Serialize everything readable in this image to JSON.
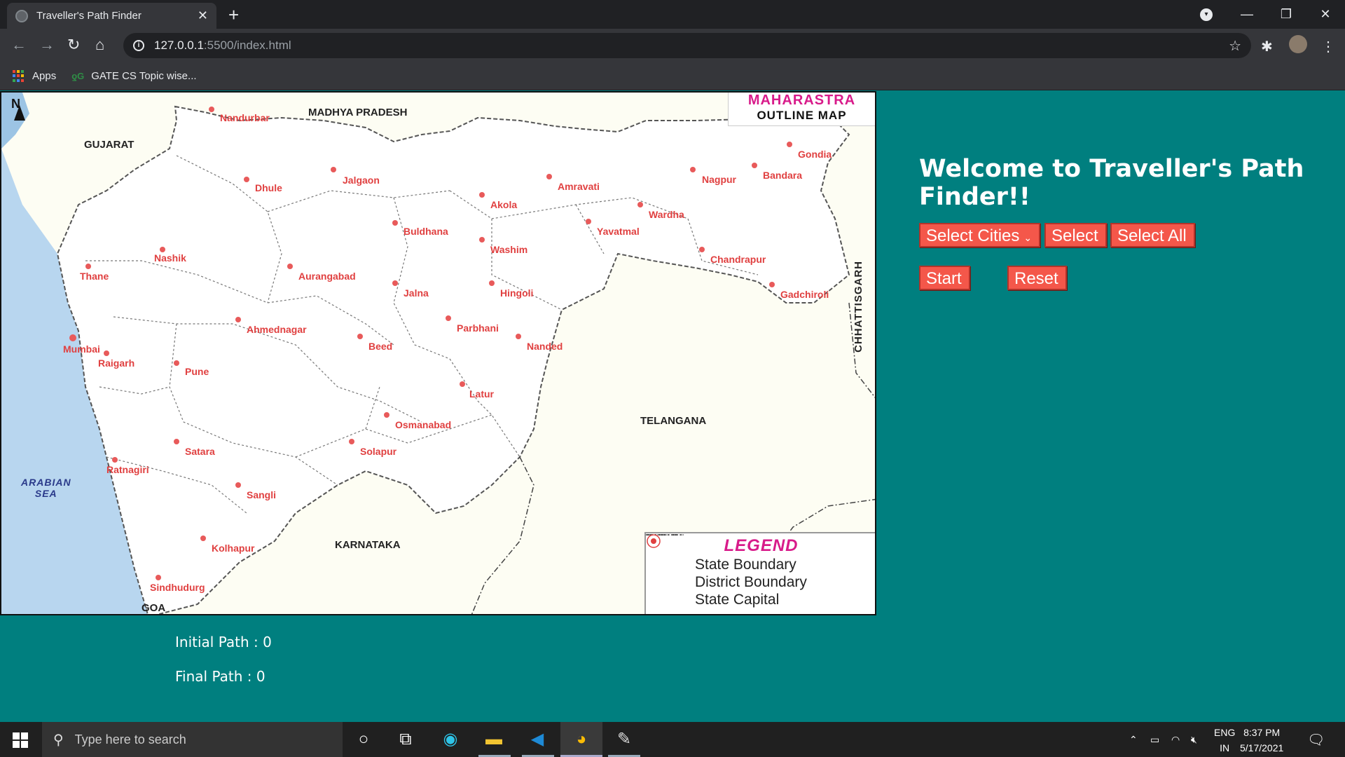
{
  "browser": {
    "tab_title": "Traveller's Path Finder",
    "tab_close": "✕",
    "new_tab": "+",
    "url_host": "127.0.0.1",
    "url_path": ":5500/index.html",
    "bookmarks": [
      {
        "label": "Apps"
      },
      {
        "label": "GATE CS Topic wise..."
      }
    ]
  },
  "map": {
    "title_line1": "MAHARASTRA",
    "title_line2": "OUTLINE MAP",
    "north": "N",
    "regions": {
      "madhya_pradesh": "MADHYA PRADESH",
      "gujarat": "GUJARAT",
      "chhattisgarh": "CHHATTISGARH",
      "telangana": "TELANGANA",
      "karnataka": "KARNATAKA",
      "goa": "GOA",
      "arabian_sea_1": "ARABIAN",
      "arabian_sea_2": "SEA"
    },
    "cities": [
      {
        "name": "Nandurbar"
      },
      {
        "name": "Dhule"
      },
      {
        "name": "Jalgaon"
      },
      {
        "name": "Buldhana"
      },
      {
        "name": "Akola"
      },
      {
        "name": "Amravati"
      },
      {
        "name": "Nagpur"
      },
      {
        "name": "Bandara"
      },
      {
        "name": "Gondia"
      },
      {
        "name": "Wardha"
      },
      {
        "name": "Yavatmal"
      },
      {
        "name": "Washim"
      },
      {
        "name": "Chandrapur"
      },
      {
        "name": "Gadchiroli"
      },
      {
        "name": "Nashik"
      },
      {
        "name": "Thane"
      },
      {
        "name": "Aurangabad"
      },
      {
        "name": "Jalna"
      },
      {
        "name": "Hingoli"
      },
      {
        "name": "Parbhani"
      },
      {
        "name": "Nanded"
      },
      {
        "name": "Ahmednagar"
      },
      {
        "name": "Beed"
      },
      {
        "name": "Mumbai"
      },
      {
        "name": "Raigarh"
      },
      {
        "name": "Pune"
      },
      {
        "name": "Latur"
      },
      {
        "name": "Osmanabad"
      },
      {
        "name": "Satara"
      },
      {
        "name": "Solapur"
      },
      {
        "name": "Ratnagiri"
      },
      {
        "name": "Sangli"
      },
      {
        "name": "Kolhapur"
      },
      {
        "name": "Sindhudurg"
      }
    ],
    "legend": {
      "title": "LEGEND",
      "items": [
        "State Boundary",
        "District Boundary",
        "State Capital"
      ]
    }
  },
  "app": {
    "welcome": "Welcome to Traveller's Path Finder!!",
    "select_cities": "Select Cities",
    "select": "Select",
    "select_all": "Select All",
    "start": "Start",
    "reset": "Reset",
    "initial_path": "Initial Path : 0",
    "final_path": "Final Path : 0"
  },
  "taskbar": {
    "search_placeholder": "Type here to search",
    "lang_1": "ENG",
    "lang_2": "IN",
    "time": "8:37 PM",
    "date": "5/17/2021"
  }
}
